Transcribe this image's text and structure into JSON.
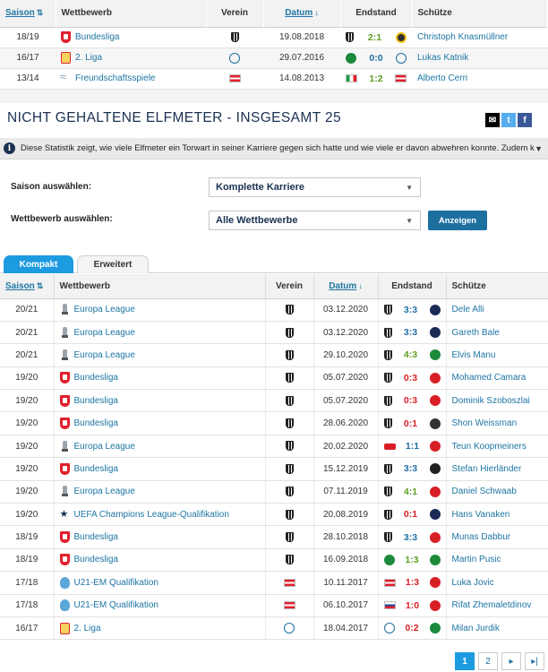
{
  "top_table": {
    "headers": {
      "season": "Saison",
      "competition": "Wettbewerb",
      "club": "Verein",
      "date": "Datum",
      "result": "Endstand",
      "scorer": "Schütze"
    },
    "rows": [
      {
        "season": "18/19",
        "competition": "Bundesliga",
        "comp_icon": "bundesliga-icon",
        "club_icon": "lask-crest-icon",
        "date": "19.08.2018",
        "home_icon": "lask-crest-icon",
        "score": "2:1",
        "score_color": "green",
        "away_icon": "club-crest-icon",
        "scorer": "Christoph Knasmüllner"
      },
      {
        "season": "16/17",
        "competition": "2. Liga",
        "comp_icon": "2-liga-icon",
        "club_icon": "round-crest-icon",
        "date": "29.07.2016",
        "home_icon": "round-crest-icon",
        "score": "0:0",
        "score_color": "blue",
        "away_icon": "round-crest-icon",
        "scorer": "Lukas Katnik"
      },
      {
        "season": "13/14",
        "competition": "Freundschaftsspiele",
        "comp_icon": "friendly-icon",
        "club_icon": "austria-flag-icon",
        "date": "14.08.2013",
        "home_icon": "italy-flag-icon",
        "score": "1:2",
        "score_color": "green",
        "away_icon": "austria-flag-icon",
        "scorer": "Alberto Cerri"
      }
    ]
  },
  "section_title": "NICHT GEHALTENE ELFMETER - INSGESAMT 25",
  "info_text": "Diese Statistik zeigt, wie viele Elfmeter ein Torwart in seiner Karriere gegen sich hatte und wie viele er davon abwehren konnte. Zudem kann ...",
  "filters": {
    "season_label": "Saison auswählen:",
    "season_value": "Komplette Karriere",
    "competition_label": "Wettbewerb auswählen:",
    "competition_value": "Alle Wettbewerbe",
    "show_button": "Anzeigen"
  },
  "tabs": {
    "compact": "Kompakt",
    "extended": "Erweitert"
  },
  "main_table": {
    "headers": {
      "season": "Saison",
      "competition": "Wettbewerb",
      "club": "Verein",
      "date": "Datum",
      "result": "Endstand",
      "scorer": "Schütze"
    },
    "rows": [
      {
        "season": "20/21",
        "competition": "Europa League",
        "comp_icon": "europa-league-icon",
        "date": "03.12.2020",
        "score": "3:3",
        "score_color": "blue",
        "scorer": "Dele Alli",
        "opp_color": "#1a2a55"
      },
      {
        "season": "20/21",
        "competition": "Europa League",
        "comp_icon": "europa-league-icon",
        "date": "03.12.2020",
        "score": "3:3",
        "score_color": "blue",
        "scorer": "Gareth Bale",
        "opp_color": "#1a2a55"
      },
      {
        "season": "20/21",
        "competition": "Europa League",
        "comp_icon": "europa-league-icon",
        "date": "29.10.2020",
        "score": "4:3",
        "score_color": "green",
        "scorer": "Elvis Manu",
        "opp_color": "#1b8a3b"
      },
      {
        "season": "19/20",
        "competition": "Bundesliga",
        "comp_icon": "bundesliga-icon",
        "date": "05.07.2020",
        "score": "0:3",
        "score_color": "red",
        "scorer": "Mohamed Camara",
        "opp_color": "#d81f26"
      },
      {
        "season": "19/20",
        "competition": "Bundesliga",
        "comp_icon": "bundesliga-icon",
        "date": "05.07.2020",
        "score": "0:3",
        "score_color": "red",
        "scorer": "Dominik Szoboszlai",
        "opp_color": "#d81f26"
      },
      {
        "season": "19/20",
        "competition": "Bundesliga",
        "comp_icon": "bundesliga-icon",
        "date": "28.06.2020",
        "score": "0:1",
        "score_color": "red",
        "scorer": "Shon Weissman",
        "opp_color": "#333333"
      },
      {
        "season": "19/20",
        "competition": "Europa League",
        "comp_icon": "europa-league-icon",
        "date": "20.02.2020",
        "score": "1:1",
        "score_color": "blue",
        "scorer": "Teun Koopmeiners",
        "opp_color": "#d81f26"
      },
      {
        "season": "19/20",
        "competition": "Bundesliga",
        "comp_icon": "bundesliga-icon",
        "date": "15.12.2019",
        "score": "3:3",
        "score_color": "blue",
        "scorer": "Stefan Hierländer",
        "opp_color": "#222222"
      },
      {
        "season": "19/20",
        "competition": "Europa League",
        "comp_icon": "europa-league-icon",
        "date": "07.11.2019",
        "score": "4:1",
        "score_color": "green",
        "scorer": "Daniel Schwaab",
        "opp_color": "#d81f26"
      },
      {
        "season": "19/20",
        "competition": "UEFA Champions League-Qualifikation",
        "comp_icon": "champions-league-icon",
        "date": "20.08.2019",
        "score": "0:1",
        "score_color": "red",
        "scorer": "Hans Vanaken",
        "opp_color": "#1a2a55"
      },
      {
        "season": "18/19",
        "competition": "Bundesliga",
        "comp_icon": "bundesliga-icon",
        "date": "28.10.2018",
        "score": "3:3",
        "score_color": "blue",
        "scorer": "Munas Dabbur",
        "opp_color": "#d81f26"
      },
      {
        "season": "18/19",
        "competition": "Bundesliga",
        "comp_icon": "bundesliga-icon",
        "date": "16.09.2018",
        "score": "1:3",
        "score_color": "green",
        "scorer": "Martin Pusic",
        "opp_color": "#1b8a3b"
      },
      {
        "season": "17/18",
        "competition": "U21-EM Qualifikation",
        "comp_icon": "u21-icon",
        "date": "10.11.2017",
        "score": "1:3",
        "score_color": "red",
        "scorer": "Luka Jovic",
        "opp_color": "#d81f26"
      },
      {
        "season": "17/18",
        "competition": "U21-EM Qualifikation",
        "comp_icon": "u21-icon",
        "date": "06.10.2017",
        "score": "1:0",
        "score_color": "red",
        "scorer": "Rifat Zhemaletdinov",
        "opp_color": "#d81f26"
      },
      {
        "season": "16/17",
        "competition": "2. Liga",
        "comp_icon": "2-liga-icon",
        "date": "18.04.2017",
        "score": "0:2",
        "score_color": "red",
        "scorer": "Milan Jurdik",
        "opp_color": "#1b8a3b"
      }
    ]
  },
  "pager": {
    "page1": "1",
    "page2": "2",
    "next": "▸",
    "last": "▸|"
  }
}
